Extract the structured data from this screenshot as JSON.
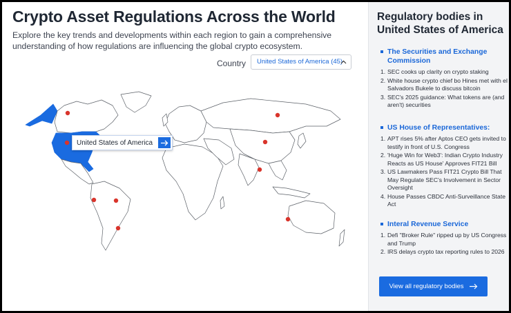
{
  "main": {
    "title": "Crypto Asset Regulations Across the World",
    "subtitle": "Explore the key trends and developments within each region to gain a comprehensive understanding of how regulations are influencing the global crypto ecosystem.",
    "country_label": "Country",
    "country_select": {
      "value": "United States of America (45)"
    },
    "map_tooltip": {
      "label": "United States of America",
      "arrow_icon": "arrow-right-icon"
    },
    "colors": {
      "accent": "#1a6be0",
      "marker": "#d9342b",
      "selected_country": "#1a6be0"
    }
  },
  "panel": {
    "title": "Regulatory bodies in United States of America",
    "sections": [
      {
        "heading": "The Securities and Exchange Commission",
        "items": [
          {
            "num": "1.",
            "text": "SEC cooks up clarity on crypto staking"
          },
          {
            "num": "2.",
            "text": "White house crypto chief bo Hines met with el Salvadors Bukele to discuss bitcoin"
          },
          {
            "num": "3.",
            "text": "SEC's 2025 guidance: What tokens are (and aren't) securities"
          }
        ]
      },
      {
        "heading": "US House of Representatives:",
        "items": [
          {
            "num": "1.",
            "text": "APT rises 5% after Aptos CEO gets invited to testify in front of U.S. Congress"
          },
          {
            "num": "2.",
            "text": "'Huge Win for Web3': Indian Crypto Industry Reacts as US House' Approves FIT21 Bill"
          },
          {
            "num": "3.",
            "text": "US Lawmakers Pass FIT21 Crypto Bill That May Regulate SEC's Involvement in Sector Oversight"
          },
          {
            "num": "4.",
            "text": "House Passes CBDC Anti-Surveillance State Act"
          }
        ]
      },
      {
        "heading": "Interal Revenue Service",
        "items": [
          {
            "num": "1.",
            "text": "Defi \"Broker Rule\" ripped up by US Congress and Trump"
          },
          {
            "num": "2.",
            "text": "IRS delays crypto tax reporting rules to 2026"
          }
        ]
      }
    ],
    "cta_label": "View all regulatory bodies",
    "cta_icon": "arrow-right-icon"
  }
}
